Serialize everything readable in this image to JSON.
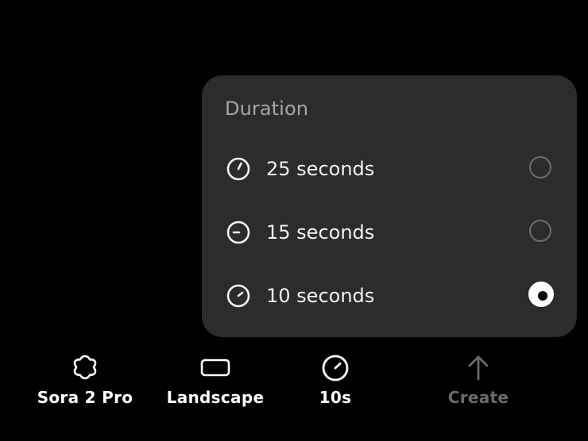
{
  "popover": {
    "title": "Duration",
    "options": [
      {
        "label": "25 seconds",
        "icon": "stopwatch-25-icon",
        "selected": false
      },
      {
        "label": "15 seconds",
        "icon": "stopwatch-15-icon",
        "selected": false
      },
      {
        "label": "10 seconds",
        "icon": "stopwatch-10-icon",
        "selected": true
      }
    ]
  },
  "toolbar": {
    "model_label": "Sora 2 Pro",
    "model_icon": "flower-icon",
    "orientation_label": "Landscape",
    "orientation_icon": "landscape-rect-icon",
    "duration_label": "10s",
    "duration_icon": "stopwatch-icon",
    "create_label": "Create",
    "create_icon": "arrow-up-icon"
  },
  "colors": {
    "background": "#000000",
    "popover_bg": "#2c2c2c",
    "muted_text": "#a6a6a6",
    "disabled_text": "#6b6b6b",
    "radio_border": "#6e6e6e"
  }
}
